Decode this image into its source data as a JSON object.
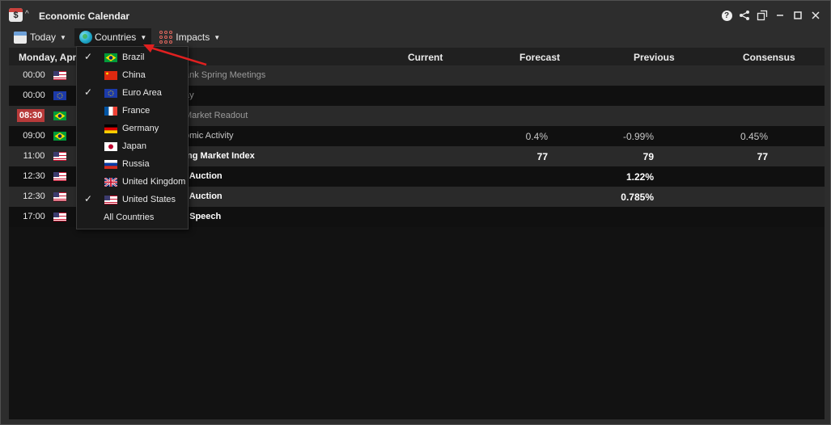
{
  "window": {
    "title": "Economic Calendar"
  },
  "toolbar": {
    "today_label": "Today",
    "countries_label": "Countries",
    "impacts_label": "Impacts"
  },
  "columns": {
    "date": "Monday, Apr",
    "current": "Current",
    "forecast": "Forecast",
    "previous": "Previous",
    "consensus": "Consensus"
  },
  "rows": [
    {
      "time": "00:00",
      "flag": "US",
      "event": "ank Spring Meetings",
      "style": "gray",
      "forecast": "",
      "previous": "",
      "consensus": ""
    },
    {
      "time": "00:00",
      "flag": "EU",
      "event": "ay",
      "style": "gray",
      "forecast": "",
      "previous": "",
      "consensus": ""
    },
    {
      "time": "08:30",
      "flag": "BR",
      "event": "Market Readout",
      "style": "gray",
      "highlight": true,
      "forecast": "",
      "previous": "",
      "consensus": ""
    },
    {
      "time": "09:00",
      "flag": "BR",
      "event": "omic Activity",
      "style": "norm",
      "forecast": "0.4%",
      "previous": "-0.99%",
      "consensus": "0.45%"
    },
    {
      "time": "11:00",
      "flag": "US",
      "event": "ing Market Index",
      "style": "bold",
      "forecast": "77",
      "previous": "79",
      "consensus": "77"
    },
    {
      "time": "12:30",
      "flag": "US",
      "event": "l Auction",
      "style": "bold",
      "forecast": "",
      "previous": "1.22%",
      "consensus": ""
    },
    {
      "time": "12:30",
      "flag": "US",
      "event": "l Auction",
      "style": "bold",
      "forecast": "",
      "previous": "0.785%",
      "consensus": ""
    },
    {
      "time": "17:00",
      "flag": "US",
      "event": "l Speech",
      "style": "bold",
      "forecast": "",
      "previous": "",
      "consensus": ""
    }
  ],
  "countries_menu": {
    "items": [
      {
        "label": "Brazil",
        "flag": "BR",
        "checked": true
      },
      {
        "label": "China",
        "flag": "CN",
        "checked": false
      },
      {
        "label": "Euro Area",
        "flag": "EU",
        "checked": true
      },
      {
        "label": "France",
        "flag": "FR",
        "checked": false
      },
      {
        "label": "Germany",
        "flag": "DE",
        "checked": false
      },
      {
        "label": "Japan",
        "flag": "JP",
        "checked": false
      },
      {
        "label": "Russia",
        "flag": "RU",
        "checked": false
      },
      {
        "label": "United Kingdom",
        "flag": "GB",
        "checked": false
      },
      {
        "label": "United States",
        "flag": "US",
        "checked": true
      }
    ],
    "all_label": "All Countries"
  },
  "colors": {
    "highlight_time": "#b83a3a",
    "arrow": "#e02020"
  }
}
